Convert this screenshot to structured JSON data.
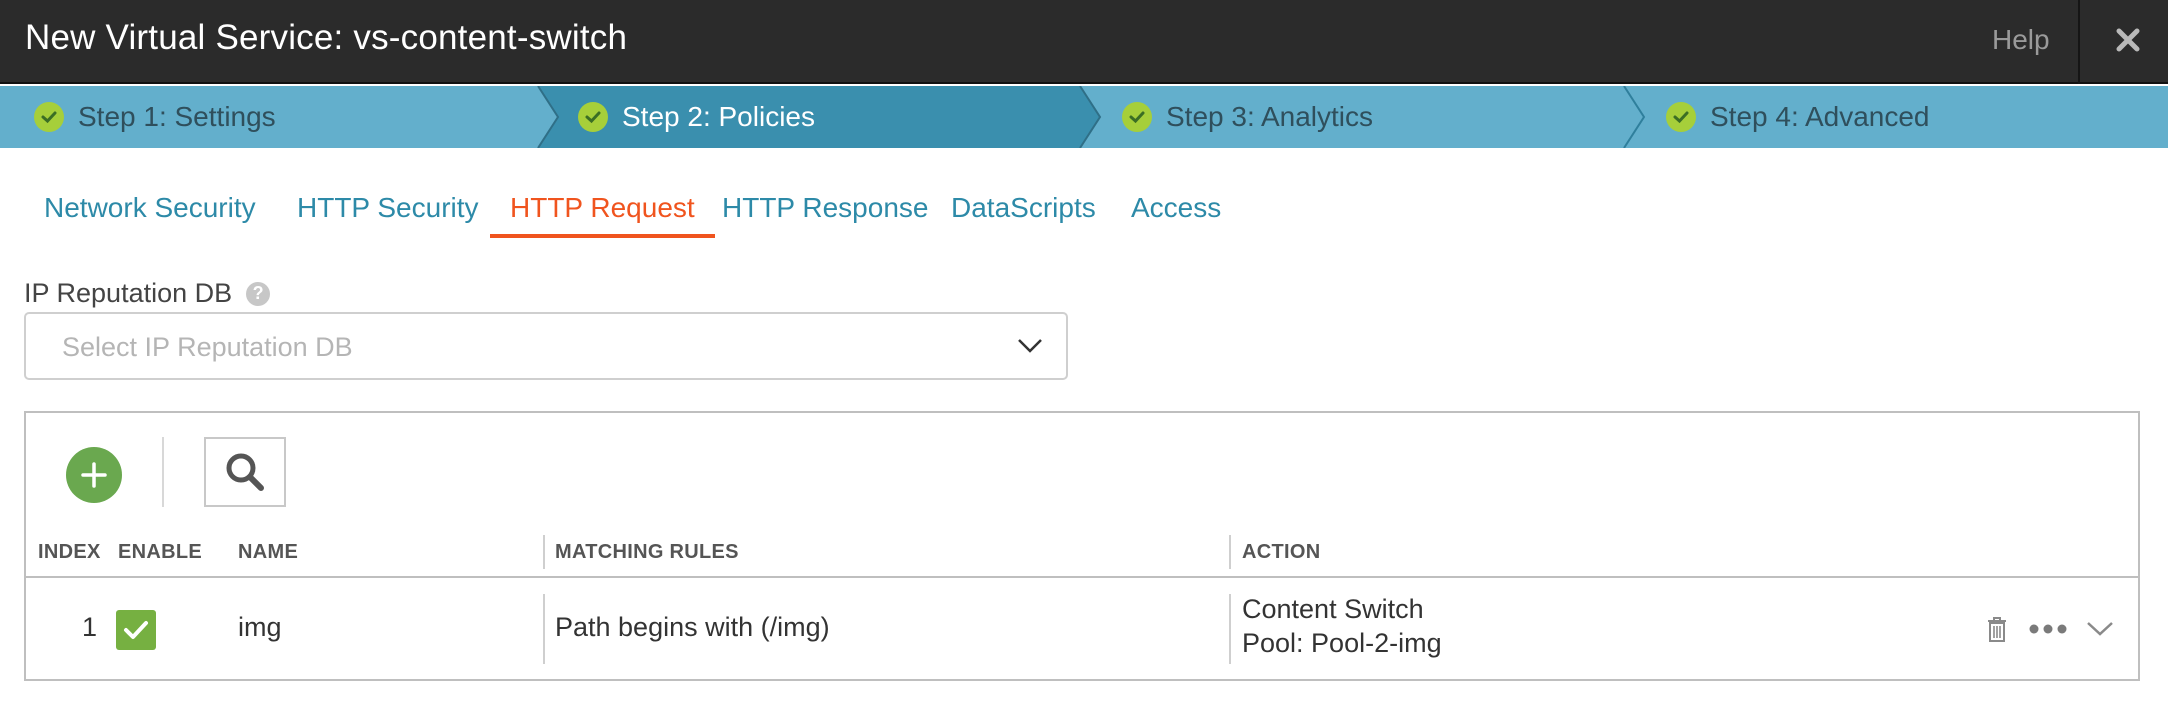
{
  "window": {
    "title": "New Virtual Service: vs-content-switch",
    "help_label": "Help",
    "close_icon": "close-icon"
  },
  "steps": [
    {
      "label": "Step 1: Settings",
      "state": "complete"
    },
    {
      "label": "Step 2: Policies",
      "state": "active"
    },
    {
      "label": "Step 3: Analytics",
      "state": "complete"
    },
    {
      "label": "Step 4: Advanced",
      "state": "complete"
    }
  ],
  "tabs": [
    {
      "label": "Network Security"
    },
    {
      "label": "HTTP Security"
    },
    {
      "label": "HTTP Request",
      "active": true
    },
    {
      "label": "HTTP Response"
    },
    {
      "label": "DataScripts"
    },
    {
      "label": "Access"
    }
  ],
  "ip_reputation": {
    "label": "IP Reputation DB",
    "placeholder": "Select IP Reputation DB"
  },
  "table": {
    "columns": [
      "INDEX",
      "ENABLE",
      "NAME",
      "MATCHING RULES",
      "ACTION"
    ],
    "rows": [
      {
        "index": "1",
        "enabled": true,
        "name": "img",
        "matching_rules": "Path begins with (/img)",
        "action_line1": "Content Switch",
        "action_line2": "Pool: Pool-2-img"
      }
    ]
  },
  "colors": {
    "title_bar": "#2b2b2b",
    "steps_bar": "#63afcc",
    "active_step": "#3a8fae",
    "tab_link": "#2d8aa8",
    "active_tab": "#f0541e",
    "check_green": "#a6cf3a",
    "add_button": "#6aa84f"
  }
}
